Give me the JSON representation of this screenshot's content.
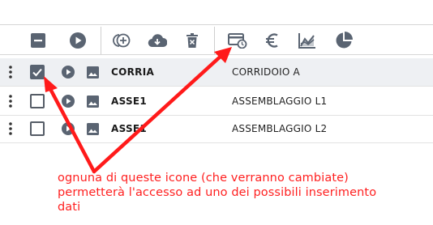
{
  "toolbar": {
    "buttons": [
      {
        "name": "collapse-button",
        "icon": "minus-square-icon"
      },
      {
        "name": "play-button",
        "icon": "play-circle-icon"
      },
      {
        "name": "add-button",
        "icon": "add-circle-icon"
      },
      {
        "name": "cloud-download-button",
        "icon": "cloud-download-icon"
      },
      {
        "name": "delete-button",
        "icon": "trash-icon"
      },
      {
        "name": "payment-schedule-button",
        "icon": "card-clock-icon"
      },
      {
        "name": "euro-button",
        "icon": "euro-icon"
      },
      {
        "name": "chart-button",
        "icon": "area-chart-icon"
      },
      {
        "name": "pie-button",
        "icon": "pie-chart-icon"
      }
    ]
  },
  "rows": [
    {
      "code": "CORRIA",
      "description": "CORRIDOIO A",
      "checked": true
    },
    {
      "code": "ASSE1",
      "description": "ASSEMBLAGGIO L1",
      "checked": false
    },
    {
      "code": "ASSE1",
      "description": "ASSEMBLAGGIO L2",
      "checked": false
    }
  ],
  "annotation": {
    "line1": "ognuna di queste icone (che verranno cambiate)",
    "line2": "permetterà l'accesso ad uno dei possibili inserimento",
    "line3": "dati",
    "color": "#ff2020"
  },
  "colors": {
    "icon": "#5a6472",
    "annotation": "#ff2020"
  }
}
